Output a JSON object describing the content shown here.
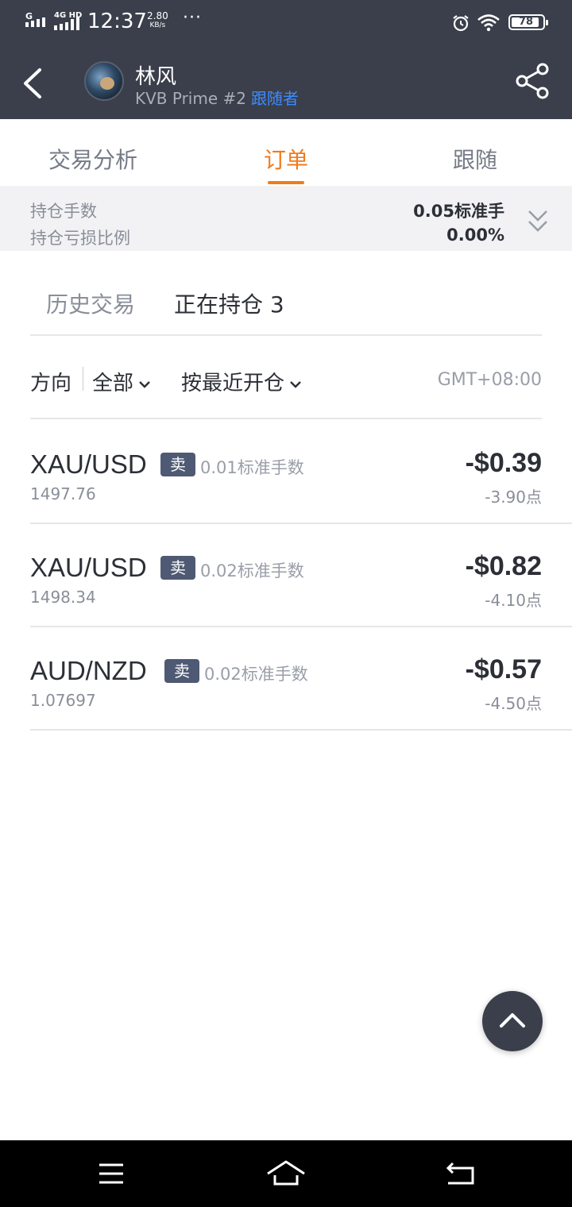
{
  "status": {
    "carrier_left": "G",
    "carrier_right": "4G HD",
    "time": "12:37",
    "speed_value": "2.80",
    "speed_unit": "KB/s",
    "more": "···",
    "battery": "78"
  },
  "header": {
    "name": "林风",
    "account": "KVB Prime #2",
    "role": "跟随者"
  },
  "tabs": [
    {
      "label": "交易分析",
      "active": false
    },
    {
      "label": "订单",
      "active": true
    },
    {
      "label": "跟随",
      "active": false
    }
  ],
  "summary": {
    "lots_label": "持仓手数",
    "lots_value": "0.05标准手",
    "ratio_label": "持仓亏损比例",
    "ratio_value": "0.00%"
  },
  "subtabs": {
    "history": "历史交易",
    "open": "正在持仓 3"
  },
  "filters": {
    "direction_label": "方向",
    "direction_value": "全部",
    "sort_value": "按最近开仓",
    "timezone": "GMT+08:00"
  },
  "positions": [
    {
      "symbol": "XAU/USD",
      "side": "卖",
      "lots": "0.01标准手数",
      "price": "1497.76",
      "pnl": "-$0.39",
      "points": "-3.90点"
    },
    {
      "symbol": "XAU/USD",
      "side": "卖",
      "lots": "0.02标准手数",
      "price": "1498.34",
      "pnl": "-$0.82",
      "points": "-4.10点"
    },
    {
      "symbol": "AUD/NZD",
      "side": "卖",
      "lots": "0.02标准手数",
      "price": "1.07697",
      "pnl": "-$0.57",
      "points": "-4.50点"
    }
  ],
  "colors": {
    "header_bg": "#3a3f4b",
    "accent": "#f27a1a",
    "role_blue": "#3d8bff",
    "badge_bg": "#4e5a73"
  },
  "icons": [
    "back-arrow-icon",
    "share-icon",
    "chevron-double-down-icon",
    "chevron-down-icon",
    "arrow-up-icon",
    "menu-icon",
    "home-icon",
    "back-nav-icon"
  ]
}
